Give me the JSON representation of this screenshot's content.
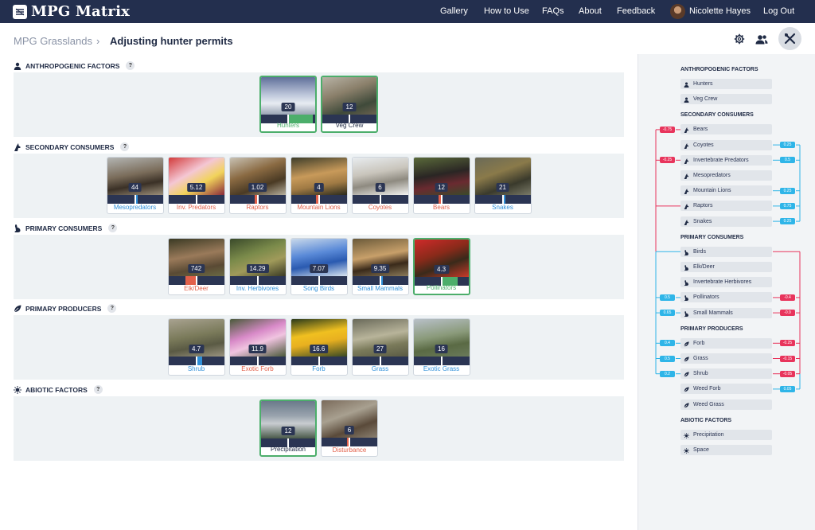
{
  "app": {
    "title": "MPG Matrix"
  },
  "nav": {
    "links": [
      "Gallery",
      "How to Use",
      "FAQs",
      "About",
      "Feedback"
    ],
    "user": "Nicolette Hayes",
    "logout": "Log Out"
  },
  "breadcrumb": {
    "parent": "MPG Grasslands",
    "separator": "›",
    "current": "Adjusting hunter permits"
  },
  "toolbar": {
    "icons": [
      "gear-icon",
      "users-icon",
      "tools-icon"
    ]
  },
  "colors": {
    "nav": "#232f4e",
    "selected": "#4cae6b",
    "negative": "#e8345c",
    "positive": "#2fb5e8",
    "band": "#eef2f4"
  },
  "sections": [
    {
      "title": "ANTHROPOGENIC FACTORS",
      "help": "?",
      "icon": "person-icon",
      "cards": [
        {
          "name": "Hunters",
          "value": "20",
          "selected": true,
          "tone": "green",
          "fill": 0.45
        },
        {
          "name": "Veg Crew",
          "value": "12",
          "selected": true,
          "tone": "dark",
          "fill": 0.0
        }
      ]
    },
    {
      "title": "SECONDARY CONSUMERS",
      "help": "?",
      "icon": "wolf-icon",
      "cards": [
        {
          "name": "Mesopredators",
          "value": "44",
          "selected": false,
          "tone": "blue",
          "fill": 0.05
        },
        {
          "name": "Inv. Predators",
          "value": "5.12",
          "selected": false,
          "tone": "red",
          "fill": 0.0
        },
        {
          "name": "Raptors",
          "value": "1.02",
          "selected": false,
          "tone": "red",
          "fill": 0.05
        },
        {
          "name": "Mountain Lions",
          "value": "4",
          "selected": false,
          "tone": "red",
          "fill": 0.05
        },
        {
          "name": "Coyotes",
          "value": "6",
          "selected": false,
          "tone": "red",
          "fill": 0.0
        },
        {
          "name": "Bears",
          "value": "12",
          "selected": false,
          "tone": "red",
          "fill": 0.05
        },
        {
          "name": "Snakes",
          "value": "21",
          "selected": false,
          "tone": "blue",
          "fill": 0.05
        }
      ]
    },
    {
      "title": "PRIMARY CONSUMERS",
      "help": "?",
      "icon": "rabbit-icon",
      "cards": [
        {
          "name": "Elk/Deer",
          "value": "742",
          "selected": false,
          "tone": "red",
          "fill": 0.2
        },
        {
          "name": "Inv. Herbivores",
          "value": "14.29",
          "selected": false,
          "tone": "blue",
          "fill": 0.0
        },
        {
          "name": "Song Birds",
          "value": "7.07",
          "selected": false,
          "tone": "blue",
          "fill": 0.0
        },
        {
          "name": "Small Mammals",
          "value": "9.35",
          "selected": false,
          "tone": "blue",
          "fill": 0.05
        },
        {
          "name": "Pollinators",
          "value": "4.3",
          "selected": true,
          "tone": "green",
          "fill": 0.3
        }
      ]
    },
    {
      "title": "PRIMARY PRODUCERS",
      "help": "?",
      "icon": "leaf-icon",
      "cards": [
        {
          "name": "Shrub",
          "value": "4.7",
          "selected": false,
          "tone": "blue",
          "fill": 0.1
        },
        {
          "name": "Exotic Forb",
          "value": "11.9",
          "selected": false,
          "tone": "red",
          "fill": 0.0
        },
        {
          "name": "Forb",
          "value": "16.6",
          "selected": false,
          "tone": "blue",
          "fill": 0.0
        },
        {
          "name": "Grass",
          "value": "27",
          "selected": false,
          "tone": "blue",
          "fill": 0.0
        },
        {
          "name": "Exotic Grass",
          "value": "16",
          "selected": false,
          "tone": "blue",
          "fill": 0.0
        }
      ]
    },
    {
      "title": "ABIOTIC FACTORS",
      "help": "?",
      "icon": "sun-icon",
      "cards": [
        {
          "name": "Precipitation",
          "value": "12",
          "selected": true,
          "tone": "dark",
          "fill": 0.0
        },
        {
          "name": "Disturbance",
          "value": "6",
          "selected": false,
          "tone": "red",
          "fill": 0.05
        }
      ]
    }
  ],
  "panel": {
    "groups": [
      {
        "title": "ANTHROPOGENIC FACTORS",
        "icon": "person-icon",
        "items": [
          "Hunters",
          "Veg Crew"
        ]
      },
      {
        "title": "SECONDARY CONSUMERS",
        "icon": "wolf-icon",
        "items": [
          "Bears",
          "Coyotes",
          "Invertebrate Predators",
          "Mesopredators",
          "Mountain Lions",
          "Raptors",
          "Snakes"
        ]
      },
      {
        "title": "PRIMARY CONSUMERS",
        "icon": "rabbit-icon",
        "items": [
          "Birds",
          "Elk/Deer",
          "Invertebrate Herbivores",
          "Pollinators",
          "Small Mammals"
        ]
      },
      {
        "title": "PRIMARY PRODUCERS",
        "icon": "leaf-icon",
        "items": [
          "Forb",
          "Grass",
          "Shrub",
          "Weed Forb",
          "Weed Grass"
        ]
      },
      {
        "title": "ABIOTIC FACTORS",
        "icon": "sun-icon",
        "items": [
          "Precipitation",
          "Space"
        ]
      }
    ],
    "left_chips": [
      {
        "item": "Bears",
        "value": "-0.75",
        "sign": "neg"
      },
      {
        "item": "Invertebrate Predators",
        "value": "-0.25",
        "sign": "neg"
      },
      {
        "item": "Pollinators",
        "value": "0.5",
        "sign": "pos"
      },
      {
        "item": "Small Mammals",
        "value": "0.65",
        "sign": "pos"
      },
      {
        "item": "Forb",
        "value": "0.4",
        "sign": "pos"
      },
      {
        "item": "Grass",
        "value": "0.5",
        "sign": "pos"
      },
      {
        "item": "Shrub",
        "value": "0.2",
        "sign": "pos"
      }
    ],
    "right_chips": [
      {
        "item": "Coyotes",
        "value": "0.25",
        "sign": "pos"
      },
      {
        "item": "Invertebrate Predators",
        "value": "0.5",
        "sign": "pos"
      },
      {
        "item": "Mountain Lions",
        "value": "0.25",
        "sign": "pos"
      },
      {
        "item": "Raptors",
        "value": "0.75",
        "sign": "pos"
      },
      {
        "item": "Snakes",
        "value": "0.25",
        "sign": "pos"
      },
      {
        "item": "Pollinators",
        "value": "-0.4",
        "sign": "neg"
      },
      {
        "item": "Small Mammals",
        "value": "-0.9",
        "sign": "neg"
      },
      {
        "item": "Forb",
        "value": "-0.25",
        "sign": "neg"
      },
      {
        "item": "Grass",
        "value": "-0.15",
        "sign": "neg"
      },
      {
        "item": "Shrub",
        "value": "-0.05",
        "sign": "neg"
      },
      {
        "item": "Weed Forb",
        "value": "0.05",
        "sign": "pos"
      }
    ]
  }
}
